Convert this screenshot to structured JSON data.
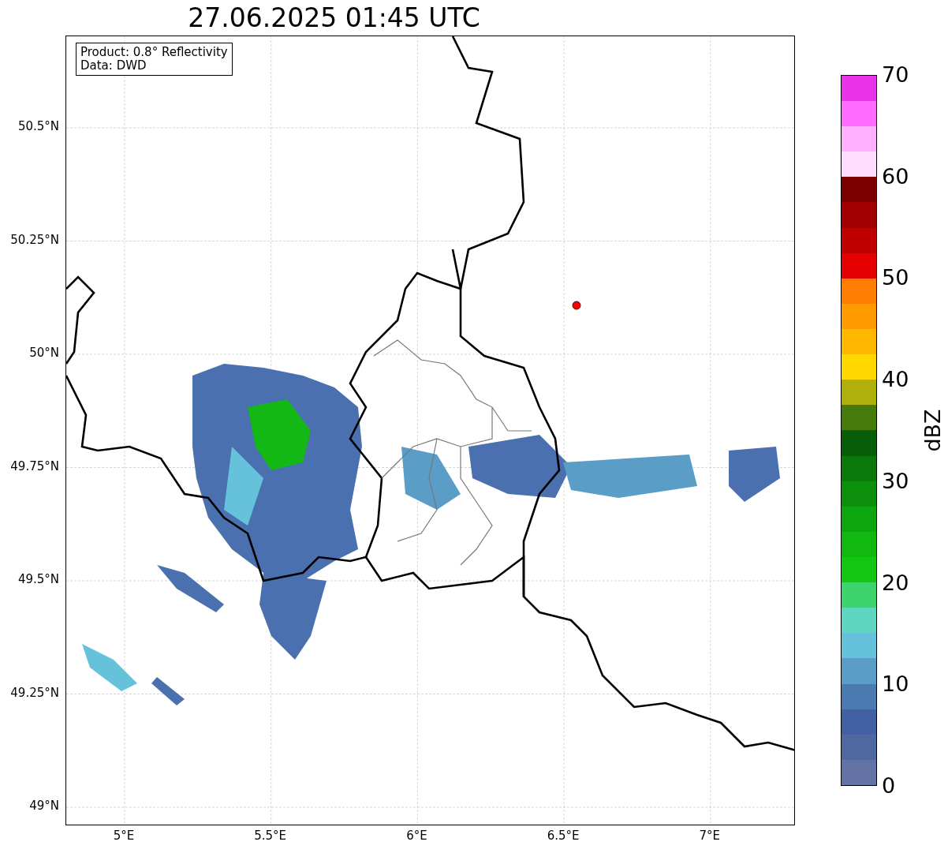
{
  "title": "27.06.2025 01:45 UTC",
  "info_box": {
    "lines": [
      "Product: 0.8° Reflectivity",
      "Data: DWD"
    ]
  },
  "y_ticks": [
    "50.5°N",
    "50.25°N",
    "50°N",
    "49.75°N",
    "49.5°N",
    "49.25°N",
    "49°N"
  ],
  "x_ticks": [
    "5°E",
    "5.5°E",
    "6°E",
    "6.5°E",
    "7°E"
  ],
  "colorbar": {
    "label": "dBZ",
    "ticks": [
      "70",
      "60",
      "50",
      "40",
      "30",
      "20",
      "10",
      "0"
    ],
    "bands": [
      {
        "color": "#6473a6"
      },
      {
        "color": "#5068a0"
      },
      {
        "color": "#4360a4"
      },
      {
        "color": "#4a7ab0"
      },
      {
        "color": "#5a9ec8"
      },
      {
        "color": "#66c2db"
      },
      {
        "color": "#5ed6c2"
      },
      {
        "color": "#3dd46e"
      },
      {
        "color": "#12c612"
      },
      {
        "color": "#10b810"
      },
      {
        "color": "#0ea60e"
      },
      {
        "color": "#0c900c"
      },
      {
        "color": "#0a780a"
      },
      {
        "color": "#085e08"
      },
      {
        "color": "#467a0a"
      },
      {
        "color": "#b0b00a"
      },
      {
        "color": "#ffd800"
      },
      {
        "color": "#ffb800"
      },
      {
        "color": "#ff9a00"
      },
      {
        "color": "#ff7e00"
      },
      {
        "color": "#e40000"
      },
      {
        "color": "#c00000"
      },
      {
        "color": "#a00000"
      },
      {
        "color": "#7c0000"
      },
      {
        "color": "#ffdcff"
      },
      {
        "color": "#ffb0ff"
      },
      {
        "color": "#ff6cff"
      },
      {
        "color": "#ea34ea"
      }
    ]
  }
}
